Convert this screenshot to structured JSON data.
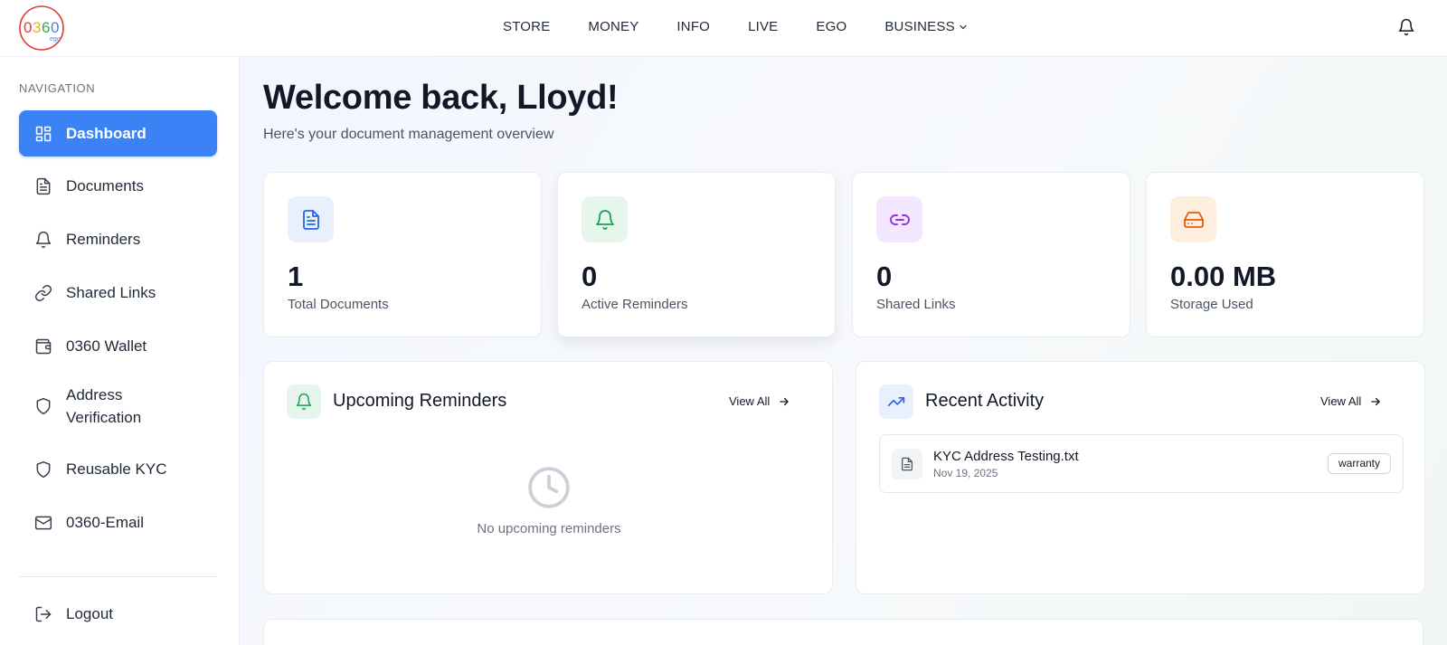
{
  "brand": {
    "logo_text": "0360",
    "logo_sub": "ego"
  },
  "topnav": {
    "items": [
      "STORE",
      "MONEY",
      "INFO",
      "LIVE",
      "EGO",
      "BUSINESS"
    ]
  },
  "sidebar": {
    "heading": "NAVIGATION",
    "items": [
      {
        "label": "Dashboard",
        "icon": "dashboard-icon"
      },
      {
        "label": "Documents",
        "icon": "document-icon"
      },
      {
        "label": "Reminders",
        "icon": "bell-icon"
      },
      {
        "label": "Shared Links",
        "icon": "link-icon"
      },
      {
        "label": "0360 Wallet",
        "icon": "wallet-icon"
      },
      {
        "label": "Address Verification",
        "icon": "shield-icon"
      },
      {
        "label": "Reusable KYC",
        "icon": "shield-icon"
      },
      {
        "label": "0360-Email",
        "icon": "mail-icon"
      }
    ],
    "logout": "Logout"
  },
  "main": {
    "title": "Welcome back, Lloyd!",
    "subtitle": "Here's your document management overview",
    "stats": [
      {
        "value": "1",
        "label": "Total Documents",
        "icon": "document-icon",
        "color": "#2563eb",
        "bg": "#e8f0fe"
      },
      {
        "value": "0",
        "label": "Active Reminders",
        "icon": "bell-icon",
        "color": "#16a34a",
        "bg": "#e7f6ec"
      },
      {
        "value": "0",
        "label": "Shared Links",
        "icon": "link-icon",
        "color": "#9333ea",
        "bg": "#f3e8ff"
      },
      {
        "value": "0.00 MB",
        "label": "Storage Used",
        "icon": "hard-drive-icon",
        "color": "#ea580c",
        "bg": "#fdeede"
      }
    ],
    "reminders_panel": {
      "title": "Upcoming Reminders",
      "view_all": "View All",
      "empty_text": "No upcoming reminders"
    },
    "activity_panel": {
      "title": "Recent Activity",
      "view_all": "View All",
      "items": [
        {
          "name": "KYC Address Testing.txt",
          "date": "Nov 19, 2025",
          "tag": "warranty"
        }
      ]
    }
  },
  "colors": {
    "accent": "#3b82f6"
  }
}
